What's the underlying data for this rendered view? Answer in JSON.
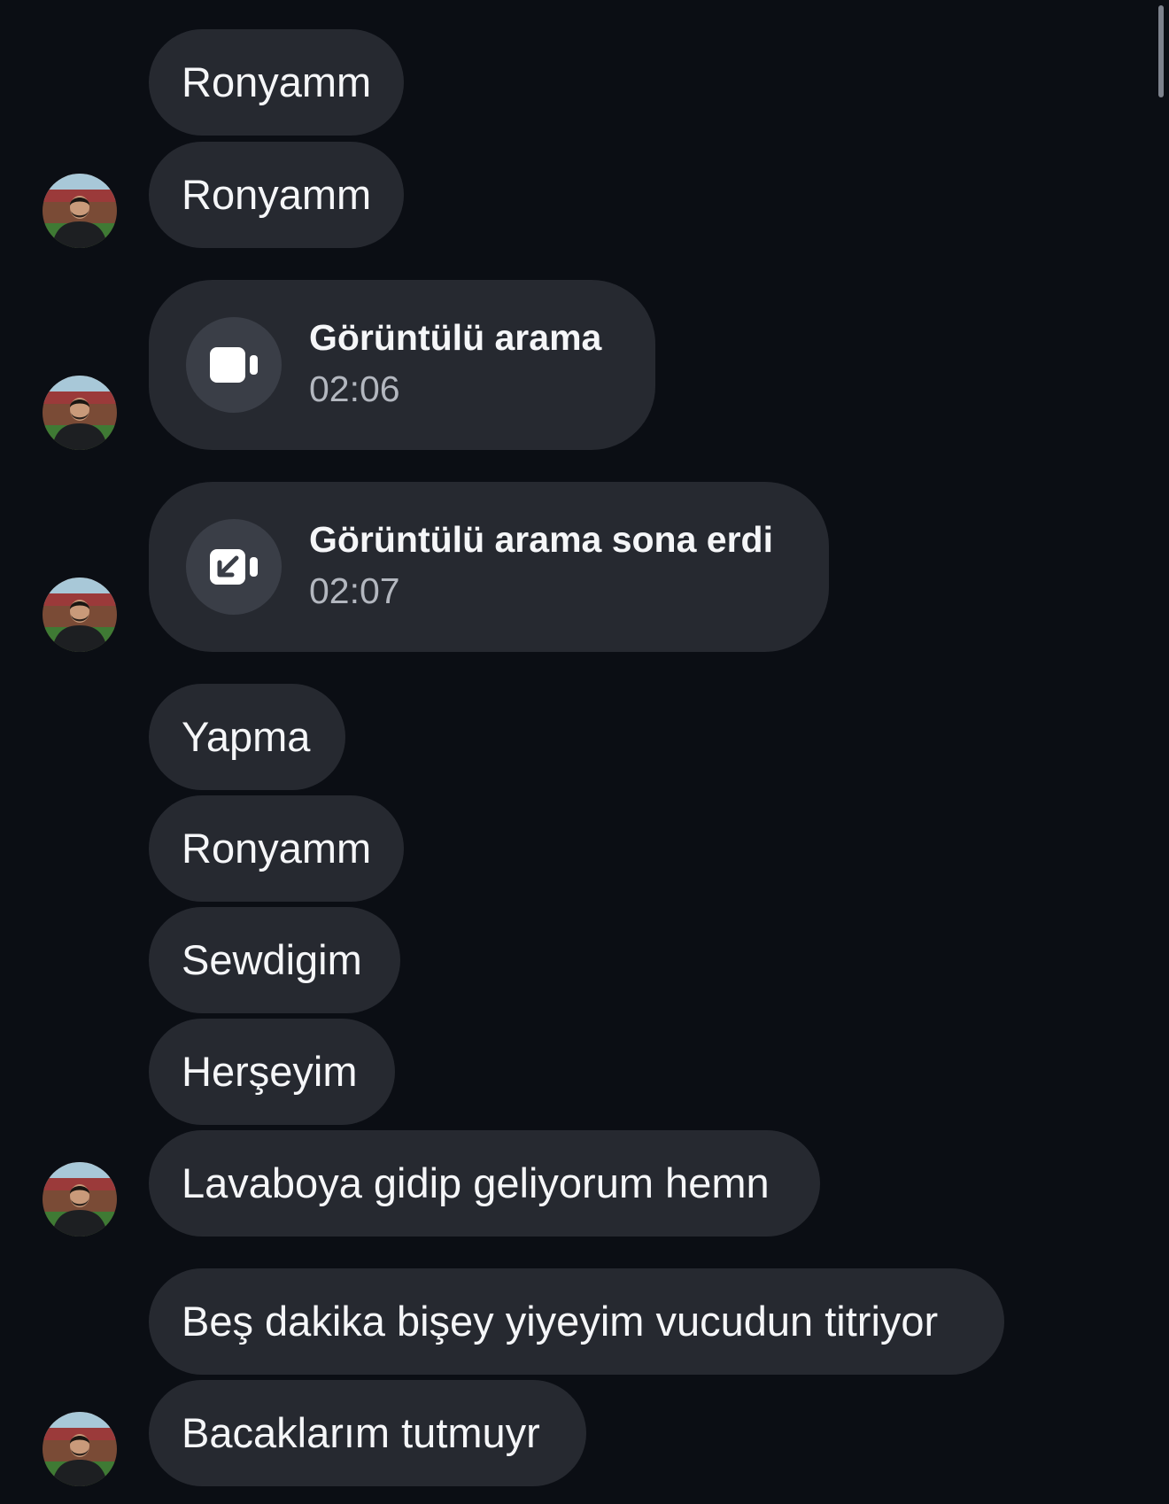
{
  "messages": [
    {
      "type": "text",
      "text": "Ronyamm",
      "avatar": false
    },
    {
      "type": "text",
      "text": "Ronyamm",
      "avatar": true
    },
    {
      "type": "call",
      "title": "Görüntülü arama",
      "time": "02:06",
      "icon": "video-camera-icon",
      "avatar": true
    },
    {
      "type": "call",
      "title": "Görüntülü arama sona erdi",
      "time": "02:07",
      "icon": "video-call-ended-icon",
      "avatar": true
    },
    {
      "type": "text",
      "text": "Yapma",
      "avatar": false
    },
    {
      "type": "text",
      "text": "Ronyamm",
      "avatar": false
    },
    {
      "type": "text",
      "text": "Sewdigim",
      "avatar": false
    },
    {
      "type": "text",
      "text": "Herşeyim",
      "avatar": false
    },
    {
      "type": "text",
      "text": "Lavaboya gidip geliyorum hemn",
      "avatar": true
    },
    {
      "type": "text",
      "text": "Beş dakika bişey yiyeyim vucudun titriyor",
      "avatar": false
    },
    {
      "type": "text",
      "text": "Bacaklarım tutmuyr",
      "avatar": true
    }
  ],
  "colors": {
    "background": "#0b0e14",
    "bubble": "#262930",
    "call_icon_bg": "#3a3e47",
    "text": "#f5f6f8",
    "secondary_text": "#b3b7bf"
  }
}
